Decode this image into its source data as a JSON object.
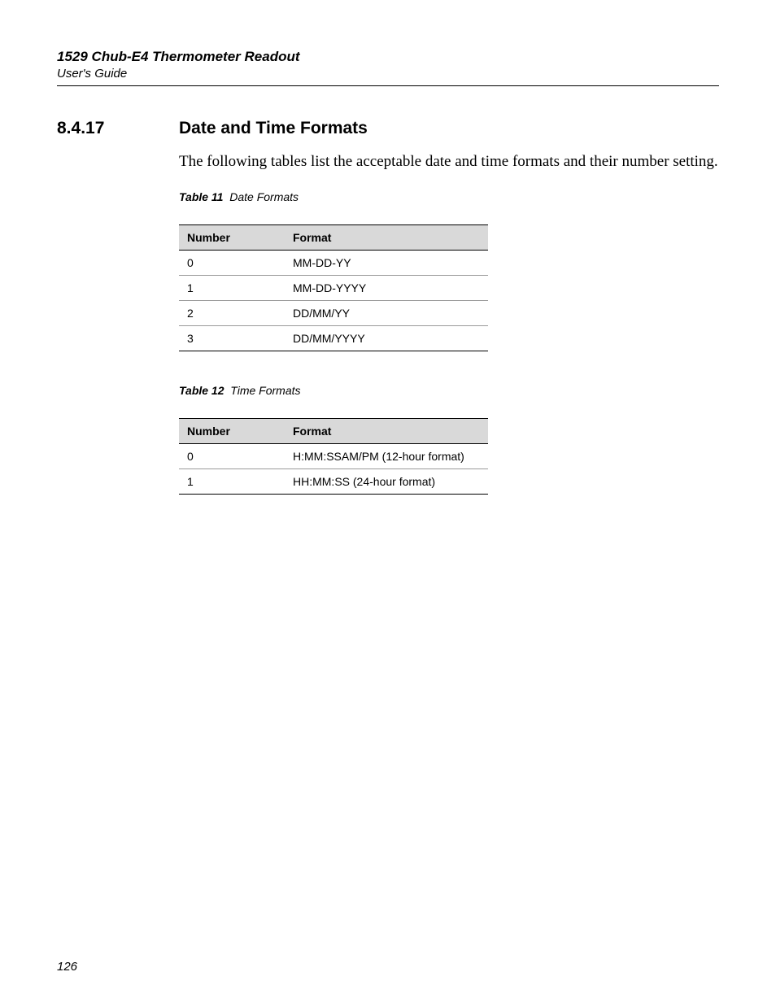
{
  "header": {
    "title": "1529 Chub-E4 Thermometer Readout",
    "subtitle": "User's Guide"
  },
  "section": {
    "number": "8.4.17",
    "title": "Date and Time Formats",
    "body": "The following tables list the acceptable date and time formats and their number setting."
  },
  "table11": {
    "caption_label": "Table 11",
    "caption_text": "Date Formats",
    "header_number": "Number",
    "header_format": "Format",
    "rows": [
      {
        "number": "0",
        "format": "MM-DD-YY"
      },
      {
        "number": "1",
        "format": "MM-DD-YYYY"
      },
      {
        "number": "2",
        "format": "DD/MM/YY"
      },
      {
        "number": "3",
        "format": "DD/MM/YYYY"
      }
    ]
  },
  "table12": {
    "caption_label": "Table 12",
    "caption_text": "Time Formats",
    "header_number": "Number",
    "header_format": "Format",
    "rows": [
      {
        "number": "0",
        "format": "H:MM:SSAM/PM (12-hour format)"
      },
      {
        "number": "1",
        "format": "HH:MM:SS (24-hour format)"
      }
    ]
  },
  "page_number": "126"
}
